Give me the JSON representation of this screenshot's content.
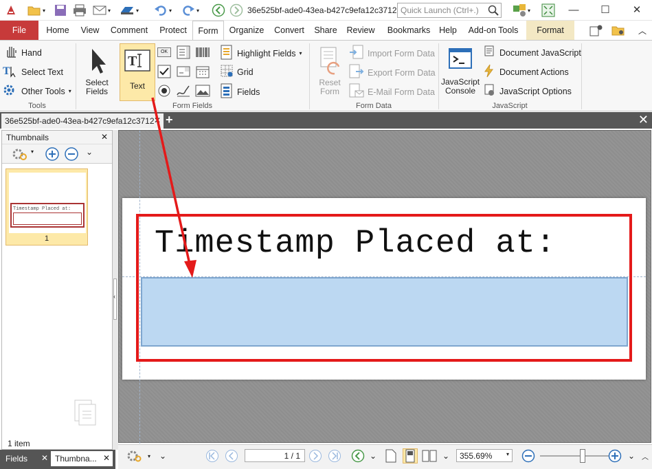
{
  "title": "36e525bf-ade0-43ea-b427c9efa12c3712 ...",
  "quick_launch": {
    "placeholder": "Quick Launch (Ctrl+.)"
  },
  "tabs": [
    "File",
    "Home",
    "View",
    "Comment",
    "Protect",
    "Form",
    "Organize",
    "Convert",
    "Share",
    "Review",
    "Bookmarks",
    "Help",
    "Add-on Tools",
    "Format"
  ],
  "active_tab": "Form",
  "ribbon": {
    "tools": {
      "hand": "Hand",
      "select_text": "Select Text",
      "other_tools": "Other Tools",
      "label": "Tools"
    },
    "form_fields": {
      "select_fields": [
        "Select",
        "Fields"
      ],
      "text": "Text",
      "highlight_fields": "Highlight Fields",
      "grid": "Grid",
      "fields": "Fields",
      "label": "Form Fields",
      "ok_label": "OK"
    },
    "form_data": {
      "reset_form": [
        "Reset",
        "Form"
      ],
      "import": "Import Form Data",
      "export": "Export Form Data",
      "email": "E-Mail Form Data",
      "label": "Form Data"
    },
    "javascript": {
      "console": [
        "JavaScript",
        "Console"
      ],
      "document_js": "Document JavaScript",
      "document_actions": "Document Actions",
      "js_options": "JavaScript Options",
      "label": "JavaScript"
    }
  },
  "doc_tab": "36e525bf-ade0-43ea-b427c9efa12c3712",
  "left_panel": {
    "title": "Thumbnails",
    "thumb_page_num": "1",
    "thumb_text": "Timestamp Placed at:",
    "item_count": "1 item"
  },
  "bottom_tabs": {
    "fields": "Fields",
    "thumbnails": "Thumbna..."
  },
  "document": {
    "stamp_text": "Timestamp Placed at:"
  },
  "status": {
    "page": "1 / 1",
    "zoom": "355.69%"
  },
  "colors": {
    "file_tab": "#c73a3a",
    "highlight": "#fde9a8",
    "annotation_red": "#e41a1a",
    "field_fill": "#bcd8f2"
  }
}
